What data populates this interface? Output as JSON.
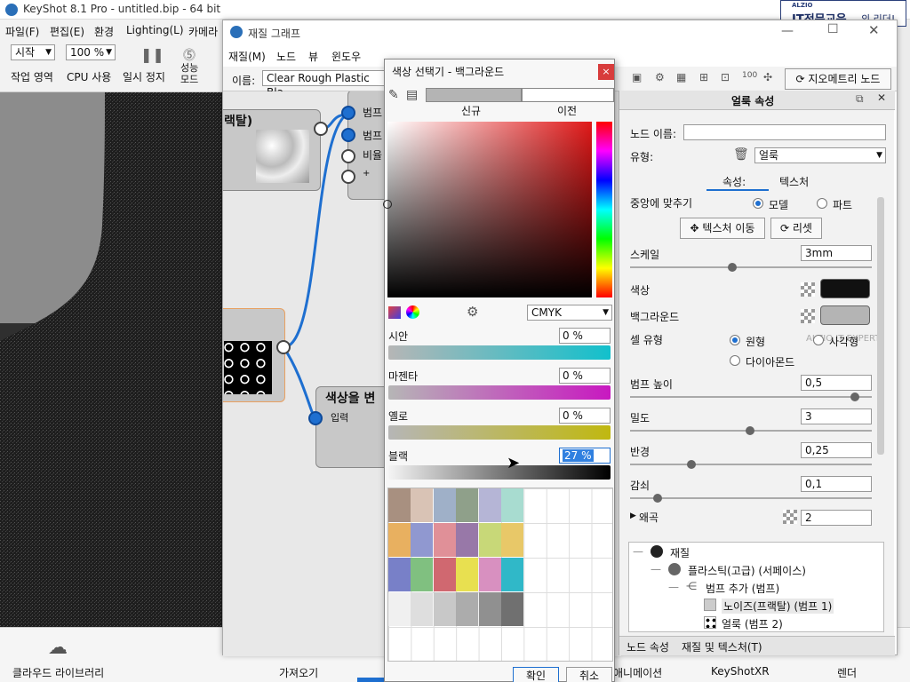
{
  "app": {
    "title": "KeyShot 8.1 Pro  - untitled.bip - 64 bit",
    "menu": [
      "파일(F)",
      "편집(E)",
      "환경",
      "Lighting(L)",
      "카메라"
    ],
    "toolbar": {
      "start_select": "시작",
      "zoom_select": "100 %",
      "work_area": "작업 영역",
      "cpu_usage": "CPU 사용",
      "pause": "일시 정지",
      "perf_mode": "성능 모드"
    },
    "bottom": {
      "cloud_library": "클라우드 라이브러리",
      "import": "가져오기",
      "animation": "애니메이션",
      "keyshotxr": "KeyShotXR",
      "render": "렌더"
    }
  },
  "ad": {
    "brand": "ALZIO",
    "text": "IT전문교육",
    "suffix": "의 리더!"
  },
  "material_graph": {
    "title": "재질 그래프",
    "menu": [
      "재질(M)",
      "노드",
      "뷰",
      "윈도우"
    ],
    "name_label": "이름:",
    "name_value": "Clear Rough Plastic Bla",
    "geometry_node_button": "지오메트리 노드",
    "nodes": {
      "noise_title": "랙탈)",
      "bump_ports": [
        "범프",
        "범프",
        "비율",
        "+"
      ],
      "color_change_title": "색상을 변",
      "input_label": "입력"
    }
  },
  "color_picker": {
    "title": "색상 선택기 - 백그라운드",
    "new_label": "신규",
    "prev_label": "이전",
    "mode": "CMYK",
    "cyan_label": "시안",
    "cyan_value": "0 %",
    "magenta_label": "마젠타",
    "magenta_value": "0 %",
    "yellow_label": "옐로",
    "yellow_value": "0 %",
    "black_label": "블랙",
    "black_value": "27 %",
    "ok": "확인",
    "cancel": "취소",
    "swatches": [
      [
        "#a89080",
        "#d9c3b5",
        "#9fb0c8",
        "#8fa08a",
        "#b5b5d6",
        "#a8dcd0"
      ],
      [
        "#e8b060",
        "#9098d0",
        "#e09098",
        "#9878a8",
        "#c8d878",
        "#e8c868"
      ],
      [
        "#7880c8",
        "#80c080",
        "#d06870",
        "#e8e050",
        "#d890c0",
        "#30b8c8"
      ],
      [
        "#f0f0f0",
        "#dedede",
        "#c8c8c8",
        "#acacac",
        "#909090",
        "#707070"
      ]
    ]
  },
  "props": {
    "title": "얼룩 속성",
    "node_name_label": "노드 이름:",
    "node_name_value": "",
    "type_label": "유형:",
    "type_value": "얼룩",
    "tab_props": "속성:",
    "tab_texture": "텍스처",
    "fit_center_label": "중앙에 맞추기",
    "opt_model": "모델",
    "opt_part": "파트",
    "move_texture": "텍스처 이동",
    "reset": "리셋",
    "scale_label": "스케일",
    "scale_value": "3mm",
    "color_label": "색상",
    "bg_label": "백그라운드",
    "cell_type_label": "셀 유형",
    "opt_circle": "원형",
    "opt_square": "사각형",
    "opt_diamond": "다이아몬드",
    "bump_height_label": "범프 높이",
    "bump_height_value": "0,5",
    "density_label": "밀도",
    "density_value": "3",
    "radius_label": "반경",
    "radius_value": "0,25",
    "falloff_label": "감쇠",
    "falloff_value": "0,1",
    "distortion_label": "왜곡",
    "distortion_value": "2",
    "tree": [
      "재질",
      "플라스틱(고급) (서페이스)",
      "범프 추가 (범프)",
      "노이즈(프랙탈) (범프 1)",
      "얼룩 (범프 2)"
    ],
    "bottom_tab_node": "노드 속성",
    "bottom_tab_material": "재질 및 텍스처(T)",
    "watermark": "ALZIO IT EXPERT",
    "colors": {
      "color_swatch": "#111111",
      "bg_swatch": "#b4b4b4"
    }
  }
}
